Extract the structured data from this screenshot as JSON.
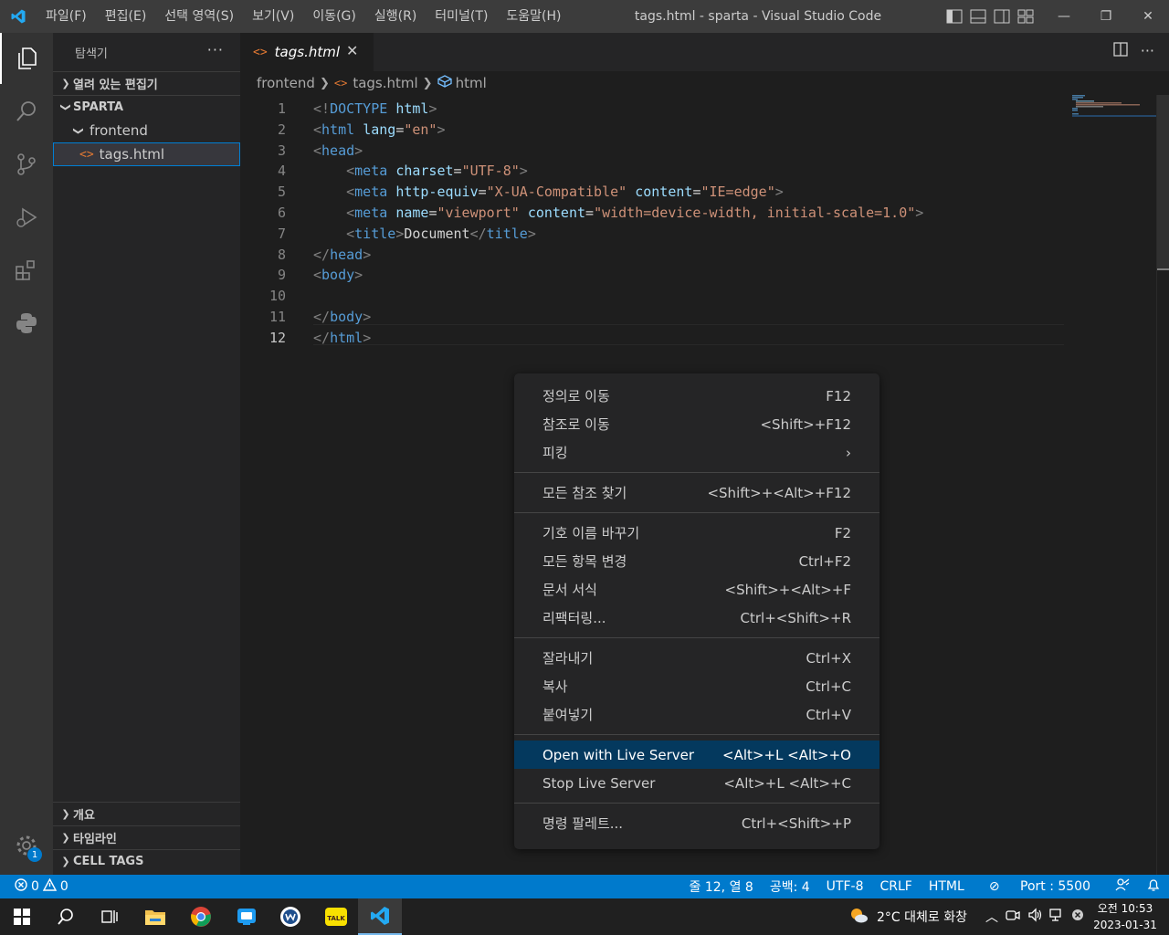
{
  "titlebar": {
    "menu": [
      "파일(F)",
      "편집(E)",
      "선택 영역(S)",
      "보기(V)",
      "이동(G)",
      "실행(R)",
      "터미널(T)",
      "도움말(H)"
    ],
    "title": "tags.html - sparta - Visual Studio Code"
  },
  "activity": {
    "settings_badge": "1"
  },
  "sidebar": {
    "title": "탐색기",
    "open_editors": "열려 있는 편집기",
    "workspace": "SPARTA",
    "folder": "frontend",
    "file": "tags.html",
    "outline": "개요",
    "timeline": "타임라인",
    "cell_tags": "CELL TAGS"
  },
  "editor": {
    "tab": "tags.html",
    "breadcrumb": [
      "frontend",
      "tags.html",
      "html"
    ],
    "lines": [
      {
        "n": "1",
        "html": "<span class='t-br'>&lt;!</span><span class='t-tag'>DOCTYPE</span> <span class='t-attr'>html</span><span class='t-br'>&gt;</span>"
      },
      {
        "n": "2",
        "html": "<span class='t-br'>&lt;</span><span class='t-tag'>html</span> <span class='t-attr'>lang</span><span class='t-txt'>=</span><span class='t-str'>\"en\"</span><span class='t-br'>&gt;</span>"
      },
      {
        "n": "3",
        "html": "<span class='t-br'>&lt;</span><span class='t-tag'>head</span><span class='t-br'>&gt;</span>"
      },
      {
        "n": "4",
        "html": "    <span class='t-br'>&lt;</span><span class='t-tag'>meta</span> <span class='t-attr'>charset</span><span class='t-txt'>=</span><span class='t-str'>\"UTF-8\"</span><span class='t-br'>&gt;</span>"
      },
      {
        "n": "5",
        "html": "    <span class='t-br'>&lt;</span><span class='t-tag'>meta</span> <span class='t-attr'>http-equiv</span><span class='t-txt'>=</span><span class='t-str'>\"X-UA-Compatible\"</span> <span class='t-attr'>content</span><span class='t-txt'>=</span><span class='t-str'>\"IE=edge\"</span><span class='t-br'>&gt;</span>"
      },
      {
        "n": "6",
        "html": "    <span class='t-br'>&lt;</span><span class='t-tag'>meta</span> <span class='t-attr'>name</span><span class='t-txt'>=</span><span class='t-str'>\"viewport\"</span> <span class='t-attr'>content</span><span class='t-txt'>=</span><span class='t-str'>\"width=device-width, initial-scale=1.0\"</span><span class='t-br'>&gt;</span>"
      },
      {
        "n": "7",
        "html": "    <span class='t-br'>&lt;</span><span class='t-tag'>title</span><span class='t-br'>&gt;</span><span class='t-txt'>Document</span><span class='t-br'>&lt;/</span><span class='t-tag'>title</span><span class='t-br'>&gt;</span>"
      },
      {
        "n": "8",
        "html": "<span class='t-br'>&lt;/</span><span class='t-tag'>head</span><span class='t-br'>&gt;</span>"
      },
      {
        "n": "9",
        "html": "<span class='t-br'>&lt;</span><span class='t-tag'>body</span><span class='t-br'>&gt;</span>"
      },
      {
        "n": "10",
        "html": ""
      },
      {
        "n": "11",
        "html": "<span class='t-br'>&lt;/</span><span class='t-tag'>body</span><span class='t-br'>&gt;</span>"
      },
      {
        "n": "12",
        "html": "<span class='t-br'>&lt;/</span><span class='t-tag'>html</span><span class='t-br'>&gt;</span>"
      }
    ]
  },
  "context_menu": {
    "groups": [
      [
        {
          "label": "정의로 이동",
          "key": "F12"
        },
        {
          "label": "참조로 이동",
          "key": "<Shift>+F12"
        },
        {
          "label": "피킹",
          "key": "›"
        }
      ],
      [
        {
          "label": "모든 참조 찾기",
          "key": "<Shift>+<Alt>+F12"
        }
      ],
      [
        {
          "label": "기호 이름 바꾸기",
          "key": "F2"
        },
        {
          "label": "모든 항목 변경",
          "key": "Ctrl+F2"
        },
        {
          "label": "문서 서식",
          "key": "<Shift>+<Alt>+F"
        },
        {
          "label": "리팩터링...",
          "key": "Ctrl+<Shift>+R"
        }
      ],
      [
        {
          "label": "잘라내기",
          "key": "Ctrl+X"
        },
        {
          "label": "복사",
          "key": "Ctrl+C"
        },
        {
          "label": "붙여넣기",
          "key": "Ctrl+V"
        }
      ],
      [
        {
          "label": "Open with Live Server",
          "key": "<Alt>+L <Alt>+O",
          "highlight": true
        },
        {
          "label": "Stop Live Server",
          "key": "<Alt>+L <Alt>+C"
        }
      ],
      [
        {
          "label": "명령 팔레트...",
          "key": "Ctrl+<Shift>+P"
        }
      ]
    ]
  },
  "statusbar": {
    "errors": "0",
    "warnings": "0",
    "position": "줄 12, 열 8",
    "spaces": "공백: 4",
    "encoding": "UTF-8",
    "eol": "CRLF",
    "language": "HTML",
    "port": "Port : 5500"
  },
  "taskbar": {
    "weather": "2°C  대체로 화창",
    "time": "오전 10:53",
    "date": "2023-01-31",
    "kakao_label": "TALK"
  },
  "colors": {
    "accent": "#007acc",
    "menu_highlight": "#04395e"
  }
}
